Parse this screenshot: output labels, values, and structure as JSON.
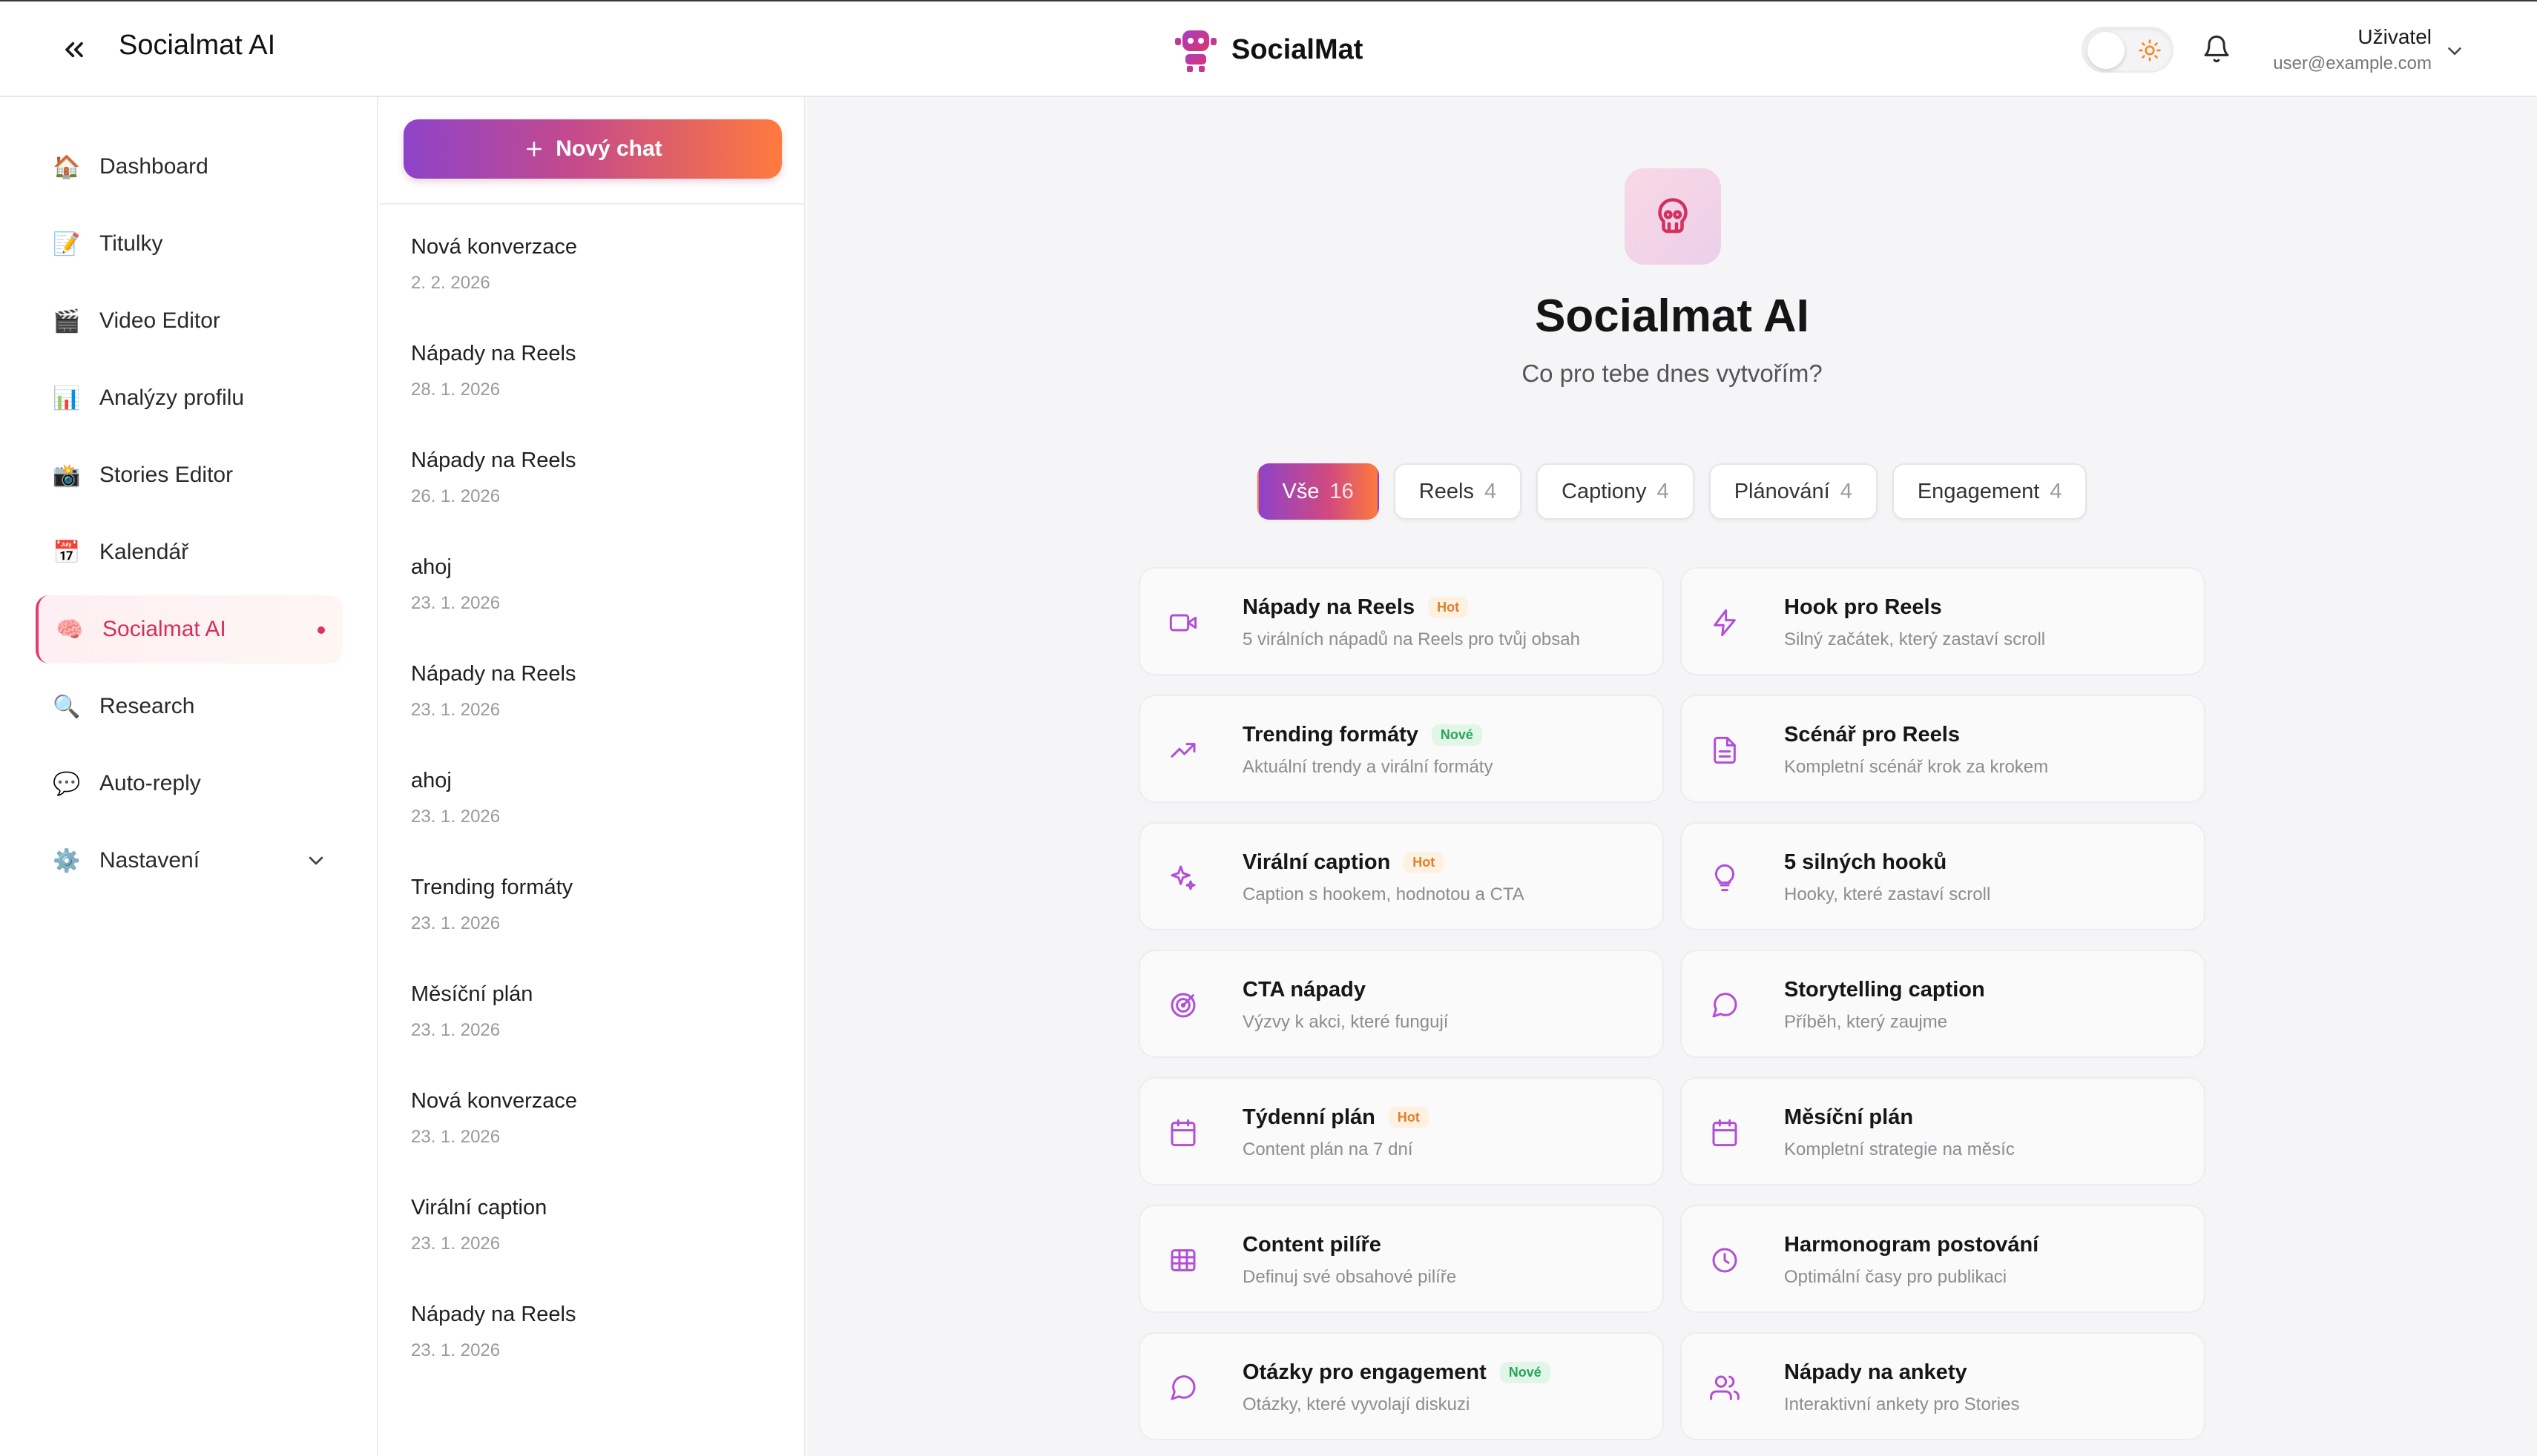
{
  "header": {
    "app_title": "Socialmat AI",
    "brand_name": "SocialMat",
    "user_name": "Uživatel",
    "user_email": "user@example.com"
  },
  "sidebar": {
    "items": [
      {
        "label": "Dashboard",
        "emoji": "🏠",
        "icon": "house-icon"
      },
      {
        "label": "Titulky",
        "emoji": "📝",
        "icon": "memo-icon"
      },
      {
        "label": "Video Editor",
        "emoji": "🎬",
        "icon": "clapper-icon"
      },
      {
        "label": "Analýzy profilu",
        "emoji": "📊",
        "icon": "bar-chart-icon"
      },
      {
        "label": "Stories Editor",
        "emoji": "📸",
        "icon": "camera-icon"
      },
      {
        "label": "Kalendář",
        "emoji": "📅",
        "icon": "calendar-icon"
      },
      {
        "label": "Socialmat AI",
        "emoji": "🧠",
        "icon": "brain-icon",
        "active": true
      },
      {
        "label": "Research",
        "emoji": "🔍",
        "icon": "magnifier-icon"
      },
      {
        "label": "Auto-reply",
        "emoji": "💬",
        "icon": "speech-bubble-icon"
      },
      {
        "label": "Nastavení",
        "emoji": "⚙️",
        "icon": "gear-icon",
        "expandable": true
      }
    ]
  },
  "chatlist": {
    "new_chat_label": "Nový chat",
    "items": [
      {
        "title": "Nová konverzace",
        "date": "2. 2. 2026"
      },
      {
        "title": "Nápady na Reels",
        "date": "28. 1. 2026"
      },
      {
        "title": "Nápady na Reels",
        "date": "26. 1. 2026"
      },
      {
        "title": "ahoj",
        "date": "23. 1. 2026"
      },
      {
        "title": "Nápady na Reels",
        "date": "23. 1. 2026"
      },
      {
        "title": "ahoj",
        "date": "23. 1. 2026"
      },
      {
        "title": "Trending formáty",
        "date": "23. 1. 2026"
      },
      {
        "title": "Měsíční plán",
        "date": "23. 1. 2026"
      },
      {
        "title": "Nová konverzace",
        "date": "23. 1. 2026"
      },
      {
        "title": "Virální caption",
        "date": "23. 1. 2026"
      },
      {
        "title": "Nápady na Reels",
        "date": "23. 1. 2026"
      }
    ]
  },
  "main": {
    "title": "Socialmat AI",
    "subtitle": "Co pro tebe dnes vytvořím?",
    "filters": [
      {
        "label": "Vše",
        "count": "16",
        "active": true
      },
      {
        "label": "Reels",
        "count": "4"
      },
      {
        "label": "Captiony",
        "count": "4"
      },
      {
        "label": "Plánování",
        "count": "4"
      },
      {
        "label": "Engagement",
        "count": "4"
      }
    ],
    "cards": [
      {
        "title": "Nápady na Reels",
        "desc": "5 virálních nápadů na Reels pro tvůj obsah",
        "badge": "Hot",
        "badge_type": "hot",
        "icon": "video-icon"
      },
      {
        "title": "Hook pro Reels",
        "desc": "Silný začátek, který zastaví scroll",
        "badge": "",
        "icon": "lightning-icon"
      },
      {
        "title": "Trending formáty",
        "desc": "Aktuální trendy a virální formáty",
        "badge": "Nové",
        "badge_type": "new",
        "icon": "trending-up-icon"
      },
      {
        "title": "Scénář pro Reels",
        "desc": "Kompletní scénář krok za krokem",
        "badge": "",
        "icon": "document-icon"
      },
      {
        "title": "Virální caption",
        "desc": "Caption s hookem, hodnotou a CTA",
        "badge": "Hot",
        "badge_type": "hot",
        "icon": "sparkles-icon"
      },
      {
        "title": "5 silných hooků",
        "desc": "Hooky, které zastaví scroll",
        "badge": "",
        "icon": "lightbulb-icon"
      },
      {
        "title": "CTA nápady",
        "desc": "Výzvy k akci, které fungují",
        "badge": "",
        "icon": "target-icon"
      },
      {
        "title": "Storytelling caption",
        "desc": "Příběh, který zaujme",
        "badge": "",
        "icon": "chat-bubble-icon"
      },
      {
        "title": "Týdenní plán",
        "desc": "Content plán na 7 dní",
        "badge": "Hot",
        "badge_type": "hot",
        "icon": "calendar-icon"
      },
      {
        "title": "Měsíční plán",
        "desc": "Kompletní strategie na měsíc",
        "badge": "",
        "icon": "calendar-icon"
      },
      {
        "title": "Content pilíře",
        "desc": "Definuj své obsahové pilíře",
        "badge": "",
        "icon": "grid-icon"
      },
      {
        "title": "Harmonogram postování",
        "desc": "Optimální časy pro publikaci",
        "badge": "",
        "icon": "clock-icon"
      },
      {
        "title": "Otázky pro engagement",
        "desc": "Otázky, které vyvolají diskuzi",
        "badge": "Nové",
        "badge_type": "new",
        "icon": "chat-bubble-icon"
      },
      {
        "title": "Nápady na ankety",
        "desc": "Interaktivní ankety pro Stories",
        "badge": "",
        "icon": "users-icon"
      }
    ]
  },
  "colors": {
    "accent_purple": "#8e43c9",
    "accent_pink": "#d2305e",
    "accent_orange": "#ff7a3d",
    "icon_purple": "#b14fd6"
  }
}
